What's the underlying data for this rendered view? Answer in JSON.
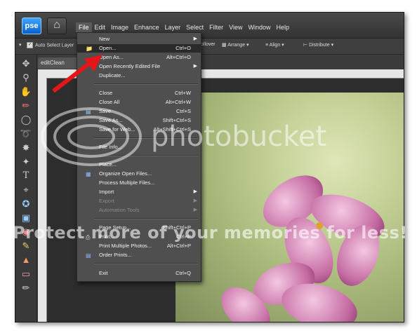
{
  "app": {
    "logo": "pse",
    "home_icon": "home-icon"
  },
  "menubar": {
    "items": [
      "File",
      "Edit",
      "Image",
      "Enhance",
      "Layer",
      "Select",
      "Filter",
      "View",
      "Window",
      "Help"
    ]
  },
  "options": {
    "auto_select": "Auto Select Layer",
    "rollover": "ollover",
    "arrange": "Arrange",
    "align": "Align",
    "distribute": "Distribute"
  },
  "document": {
    "tab": "editClean"
  },
  "file_menu": {
    "items": [
      {
        "label": "New",
        "shortcut": "",
        "submenu": true
      },
      {
        "label": "Open...",
        "shortcut": "Ctrl+O",
        "highlight": true,
        "icon": "folder-icon"
      },
      {
        "label": "Open As...",
        "shortcut": "Alt+Ctrl+O"
      },
      {
        "label": "Open Recently Edited File",
        "shortcut": "",
        "submenu": true
      },
      {
        "label": "Duplicate...",
        "shortcut": ""
      },
      {
        "label": "Close",
        "shortcut": "Ctrl+W"
      },
      {
        "label": "Close All",
        "shortcut": "Alt+Ctrl+W"
      },
      {
        "label": "Save",
        "shortcut": "Ctrl+S",
        "icon": "save-icon"
      },
      {
        "label": "Save As...",
        "shortcut": "Shift+Ctrl+S"
      },
      {
        "label": "Save for Web...",
        "shortcut": "Alt+Shift+Ctrl+S"
      },
      {
        "label": "File Info...",
        "shortcut": ""
      },
      {
        "label": "Place...",
        "shortcut": ""
      },
      {
        "label": "Organize Open Files...",
        "shortcut": "",
        "icon": "organize-icon"
      },
      {
        "label": "Process Multiple Files...",
        "shortcut": ""
      },
      {
        "label": "Import",
        "shortcut": "",
        "submenu": true
      },
      {
        "label": "Export",
        "shortcut": "",
        "submenu": true,
        "disabled": true
      },
      {
        "label": "Automation Tools",
        "shortcut": "",
        "submenu": true,
        "disabled": true
      },
      {
        "label": "Page Setup...",
        "shortcut": "Shift+Ctrl+P"
      },
      {
        "label": "Print...",
        "shortcut": "Ctrl+P",
        "icon": "print-icon"
      },
      {
        "label": "Print Multiple Photos...",
        "shortcut": "Alt+Ctrl+P"
      },
      {
        "label": "Order Prints...",
        "shortcut": "",
        "icon": "order-icon"
      },
      {
        "label": "Exit",
        "shortcut": "Ctrl+Q"
      }
    ]
  },
  "watermark": {
    "brand": "photobucket",
    "slogan": "Protect more of your memories for less!"
  }
}
